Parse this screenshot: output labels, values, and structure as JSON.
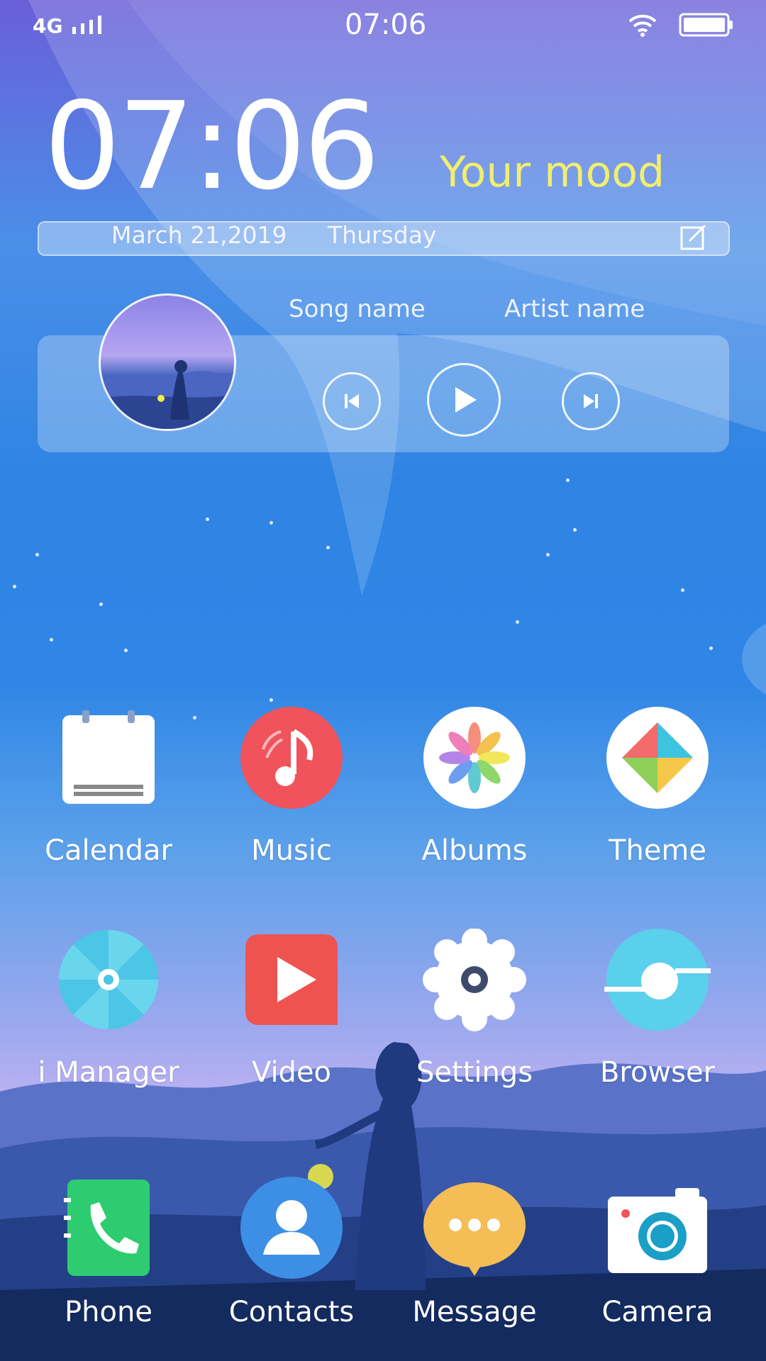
{
  "status_bar": {
    "network": "4G",
    "time": "07:06"
  },
  "clock_widget": {
    "time": "07:06",
    "mood": "Your mood",
    "date": "March 21,2019",
    "weekday": "Thursday"
  },
  "music_widget": {
    "song_name": "Song name",
    "artist_name": "Artist name"
  },
  "apps_row1": [
    {
      "label": "Calendar",
      "icon": "calendar-icon"
    },
    {
      "label": "Music",
      "icon": "music-note-icon"
    },
    {
      "label": "Albums",
      "icon": "pinwheel-icon"
    },
    {
      "label": "Theme",
      "icon": "theme-icon"
    }
  ],
  "apps_row2": [
    {
      "label": "i Manager",
      "icon": "umbrella-icon"
    },
    {
      "label": "Video",
      "icon": "play-icon"
    },
    {
      "label": "Settings",
      "icon": "gear-icon"
    },
    {
      "label": "Browser",
      "icon": "browser-icon"
    }
  ],
  "dock": [
    {
      "label": "Phone",
      "icon": "phone-icon"
    },
    {
      "label": "Contacts",
      "icon": "contact-icon"
    },
    {
      "label": "Message",
      "icon": "message-icon"
    },
    {
      "label": "Camera",
      "icon": "camera-icon"
    }
  ],
  "colors": {
    "mood_text": "#f2ee6e",
    "music_red": "#f0535b",
    "video_red": "#ef5350",
    "phone_green": "#2ecc71",
    "contacts_blue": "#3d8fe6",
    "message_yellow": "#f5bd55",
    "camera_teal": "#1a9fc7"
  }
}
